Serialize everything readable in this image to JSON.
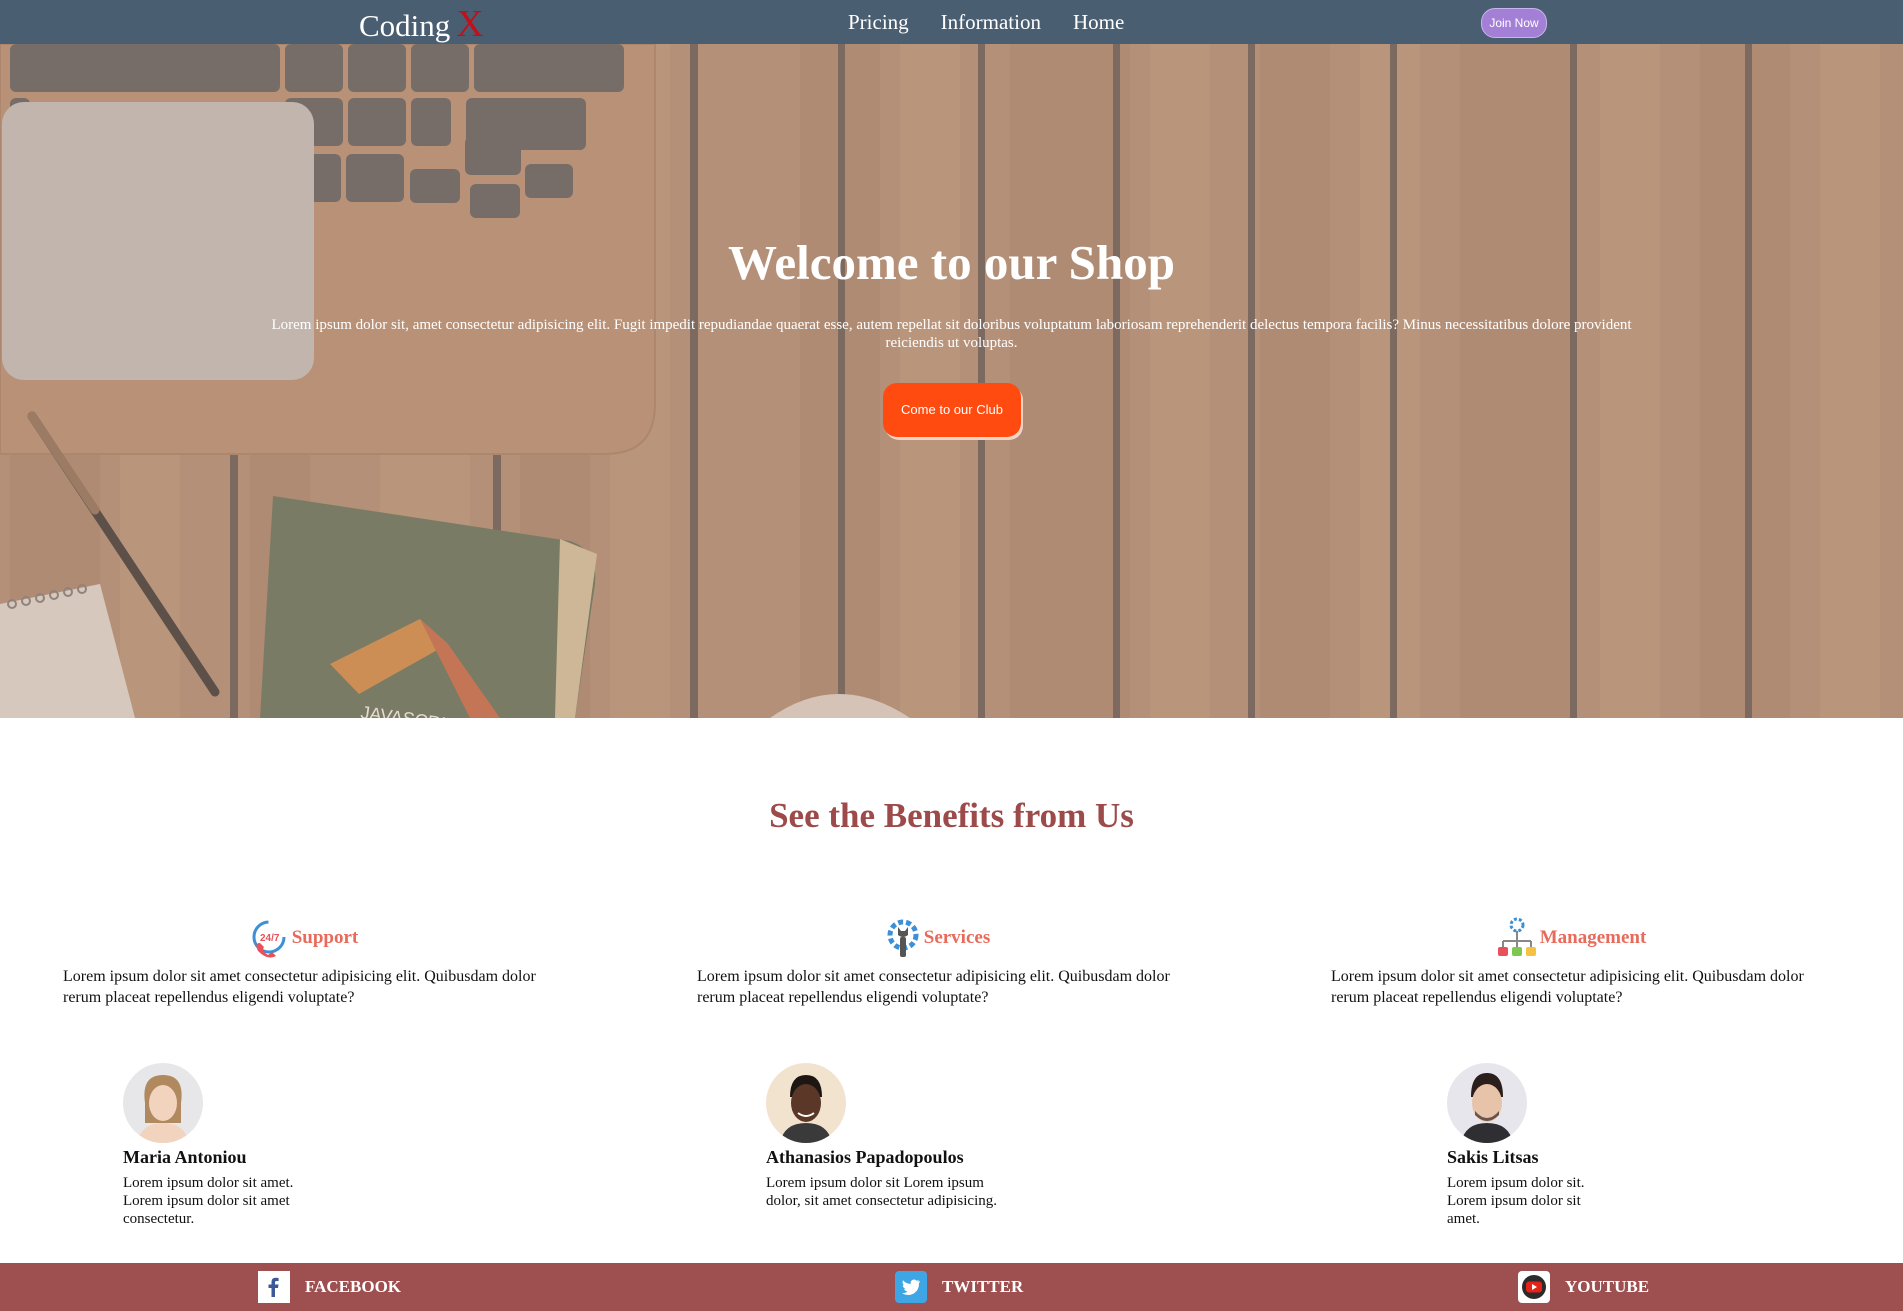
{
  "nav": {
    "logo_text": "Coding",
    "logo_accent": "X",
    "links": [
      "Pricing",
      "Information",
      "Home"
    ],
    "join_label": "Join Now"
  },
  "hero": {
    "title": "Welcome to our Shop",
    "text": "Lorem ipsum dolor sit, amet consectetur adipisicing elit. Fugit impedit repudiandae quaerat esse, autem repellat sit doloribus voluptatum laboriosam reprehenderit delectus tempora facilis? Minus necessitatibus dolore provident reiciendis ut voluptas.",
    "button_label": "Come to our Club",
    "book_label": "JAVASCRIPT"
  },
  "benefits": {
    "title": "See the Benefits from Us",
    "items": [
      {
        "icon": "support-24-7-icon",
        "label": "Support",
        "text": "Lorem ipsum dolor sit amet consectetur adipisicing elit. Quibusdam dolor rerum placeat repellendus eligendi voluptate?"
      },
      {
        "icon": "services-gear-wrench-icon",
        "label": "Services",
        "text": "Lorem ipsum dolor sit amet consectetur adipisicing elit. Quibusdam dolor rerum placeat repellendus eligendi voluptate?"
      },
      {
        "icon": "management-hierarchy-icon",
        "label": "Management",
        "text": "Lorem ipsum dolor sit amet consectetur adipisicing elit. Quibusdam dolor rerum placeat repellendus eligendi voluptate?"
      }
    ]
  },
  "team": [
    {
      "name": "Maria Antoniou",
      "text": "Lorem ipsum dolor sit amet. Lorem ipsum dolor sit amet consectetur."
    },
    {
      "name": "Athanasios Papadopoulos",
      "text": "Lorem ipsum dolor sit Lorem ipsum dolor, sit amet consectetur adipisicing."
    },
    {
      "name": "Sakis Litsas",
      "text": "Lorem ipsum dolor sit. Lorem ipsum dolor sit amet."
    }
  ],
  "footer": {
    "links": [
      {
        "icon": "facebook-icon",
        "label": "FACEBOOK"
      },
      {
        "icon": "twitter-icon",
        "label": "TWITTER"
      },
      {
        "icon": "youtube-icon",
        "label": "YOUTUBE"
      }
    ]
  },
  "colors": {
    "navbar": "#4a5e72",
    "accent_button": "#ff4b10",
    "join_button": "#a380d6",
    "benefit_title": "#9c4a4a",
    "benefit_label": "#e86a5a",
    "footer": "#9e4f50"
  }
}
